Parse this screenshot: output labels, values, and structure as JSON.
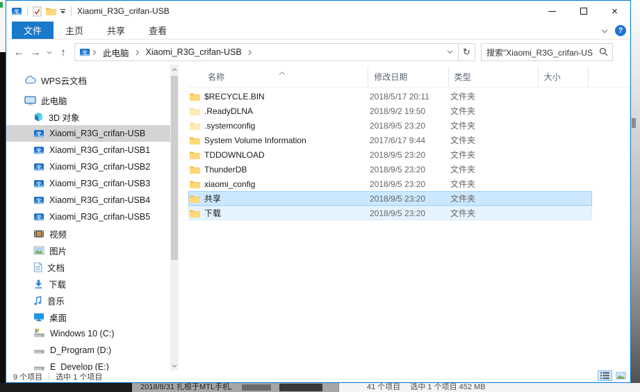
{
  "window": {
    "title": "Xiaomi_R3G_crifan-USB"
  },
  "tabs": [
    {
      "label": "文件",
      "active": true
    },
    {
      "label": "主页",
      "active": false
    },
    {
      "label": "共享",
      "active": false
    },
    {
      "label": "查看",
      "active": false
    }
  ],
  "nav": {
    "back_glyph": "←",
    "forward_glyph": "→",
    "up_glyph": "↑",
    "refresh_glyph": "↻",
    "close_glyph": "×"
  },
  "help_glyph": "?",
  "breadcrumb": {
    "items": [
      "此电脑",
      "Xiaomi_R3G_crifan-USB"
    ]
  },
  "search": {
    "value": "搜索\"Xiaomi_R3G_crifan-US"
  },
  "sidebar": {
    "items": [
      {
        "label": "WPS云文档",
        "icon": "cloud",
        "indent": 1,
        "selected": false,
        "gap_after": true
      },
      {
        "label": "此电脑",
        "icon": "computer",
        "indent": 1,
        "selected": false
      },
      {
        "label": "3D 对象",
        "icon": "cube",
        "indent": 2,
        "selected": false
      },
      {
        "label": "Xiaomi_R3G_crifan-USB",
        "icon": "network-drive",
        "indent": 2,
        "selected": true
      },
      {
        "label": "Xiaomi_R3G_crifan-USB1",
        "icon": "network-drive",
        "indent": 2,
        "selected": false
      },
      {
        "label": "Xiaomi_R3G_crifan-USB2",
        "icon": "network-drive",
        "indent": 2,
        "selected": false
      },
      {
        "label": "Xiaomi_R3G_crifan-USB3",
        "icon": "network-drive",
        "indent": 2,
        "selected": false
      },
      {
        "label": "Xiaomi_R3G_crifan-USB4",
        "icon": "network-drive",
        "indent": 2,
        "selected": false
      },
      {
        "label": "Xiaomi_R3G_crifan-USB5",
        "icon": "network-drive",
        "indent": 2,
        "selected": false
      },
      {
        "label": "视频",
        "icon": "video",
        "indent": 2,
        "selected": false
      },
      {
        "label": "图片",
        "icon": "picture",
        "indent": 2,
        "selected": false
      },
      {
        "label": "文档",
        "icon": "document",
        "indent": 2,
        "selected": false
      },
      {
        "label": "下载",
        "icon": "download",
        "indent": 2,
        "selected": false
      },
      {
        "label": "音乐",
        "icon": "music",
        "indent": 2,
        "selected": false
      },
      {
        "label": "桌面",
        "icon": "desktop",
        "indent": 2,
        "selected": false
      },
      {
        "label": "Windows 10 (C:)",
        "icon": "drive-windows",
        "indent": 2,
        "selected": false
      },
      {
        "label": "D_Program (D:)",
        "icon": "drive",
        "indent": 2,
        "selected": false
      },
      {
        "label": "E_Develop (E:)",
        "icon": "drive",
        "indent": 2,
        "selected": false
      }
    ]
  },
  "files": {
    "columns": [
      {
        "label": "名称",
        "sort": "asc"
      },
      {
        "label": "修改日期"
      },
      {
        "label": "类型"
      },
      {
        "label": "大小"
      }
    ],
    "rows": [
      {
        "name": "$RECYCLE.BIN",
        "date": "2018/5/17 20:11",
        "type": "文件夹",
        "size": "",
        "state": "",
        "faded": false
      },
      {
        "name": ".ReadyDLNA",
        "date": "2018/9/2 19:50",
        "type": "文件夹",
        "size": "",
        "state": "",
        "faded": true
      },
      {
        "name": ".systemconfig",
        "date": "2018/9/5 23:20",
        "type": "文件夹",
        "size": "",
        "state": "",
        "faded": true
      },
      {
        "name": "System Volume Information",
        "date": "2017/6/17 9:44",
        "type": "文件夹",
        "size": "",
        "state": "",
        "faded": false
      },
      {
        "name": "TDDOWNLOAD",
        "date": "2018/9/5 23:20",
        "type": "文件夹",
        "size": "",
        "state": "",
        "faded": false
      },
      {
        "name": "ThunderDB",
        "date": "2018/9/5 23:20",
        "type": "文件夹",
        "size": "",
        "state": "",
        "faded": false
      },
      {
        "name": "xiaomi_config",
        "date": "2018/9/5 23:20",
        "type": "文件夹",
        "size": "",
        "state": "",
        "faded": false
      },
      {
        "name": "共享",
        "date": "2018/9/5 23:20",
        "type": "文件夹",
        "size": "",
        "state": "selected",
        "faded": false
      },
      {
        "name": "下载",
        "date": "2018/9/5 23:20",
        "type": "文件夹",
        "size": "",
        "state": "hover",
        "faded": false
      }
    ]
  },
  "statusbar": {
    "items_count": "9 个项目",
    "selection": "选中 1 个项目"
  },
  "background": {
    "mid_text": "2018/8/31  扎根于MTL手机,",
    "right_text": "41 个项目　 选中 1 个项目  452 MB"
  }
}
